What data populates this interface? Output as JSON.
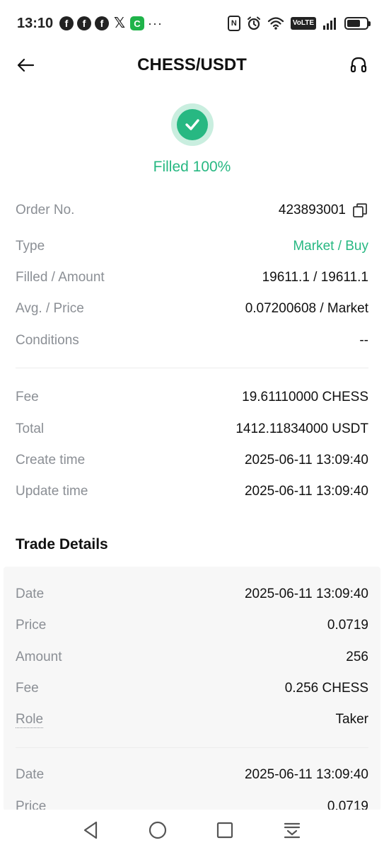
{
  "status_bar": {
    "time": "13:10",
    "notification_icons": [
      "facebook-icon",
      "facebook-icon",
      "facebook-icon",
      "x-icon",
      "c-app-icon"
    ],
    "fb_glyph": "f",
    "x_glyph": "𝕏",
    "c_glyph": "C",
    "more": "···",
    "nfc": "N",
    "volte": "VoLTE",
    "battery_level": 0.7
  },
  "header": {
    "title": "CHESS/USDT"
  },
  "order_status": {
    "text": "Filled 100%",
    "color": "#27b882"
  },
  "order": {
    "order_no_label": "Order No.",
    "order_no": "423893001",
    "type_label": "Type",
    "type": "Market / Buy",
    "filled_label": "Filled / Amount",
    "filled": "19611.1 / 19611.1",
    "avg_label": "Avg. / Price",
    "avg": "0.07200608 / Market",
    "conditions_label": "Conditions",
    "conditions": "--"
  },
  "summary": {
    "fee_label": "Fee",
    "fee": "19.61110000 CHESS",
    "total_label": "Total",
    "total": "1412.11834000 USDT",
    "create_label": "Create time",
    "create": "2025-06-11 13:09:40",
    "update_label": "Update time",
    "update": "2025-06-11 13:09:40"
  },
  "trade_details": {
    "title": "Trade Details",
    "trades": [
      {
        "date_label": "Date",
        "date": "2025-06-11 13:09:40",
        "price_label": "Price",
        "price": "0.0719",
        "amount_label": "Amount",
        "amount": "256",
        "fee_label": "Fee",
        "fee": "0.256 CHESS",
        "role_label": "Role",
        "role": "Taker"
      },
      {
        "date_label": "Date",
        "date": "2025-06-11 13:09:40",
        "price_label": "Price",
        "price": "0.0719"
      }
    ]
  },
  "colors": {
    "accent": "#27b882",
    "label": "#8b8f95"
  }
}
